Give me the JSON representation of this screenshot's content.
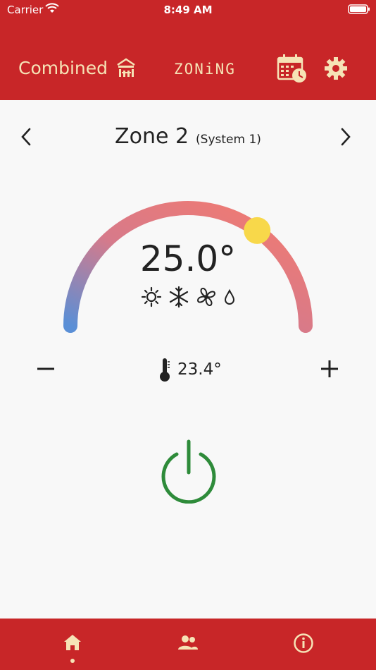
{
  "status_bar": {
    "carrier": "Carrier",
    "time": "8:49 AM"
  },
  "header": {
    "mode_label": "Combined",
    "mode_icon": "building-icon",
    "brand": "ZONiNG",
    "schedule_icon": "calendar-clock-icon",
    "settings_icon": "gear-icon"
  },
  "zone": {
    "name": "Zone 2",
    "system": "(System 1)"
  },
  "thermostat": {
    "setpoint": "25.0°",
    "ambient": "23.4°",
    "modes": [
      "sun-icon",
      "snowflake-icon",
      "fan-icon",
      "drop-icon"
    ],
    "dial_level": 0.7
  },
  "colors": {
    "primary": "#c82628",
    "accent": "#f6e3b6",
    "power": "#2e8b3a",
    "knob": "#f8d84a"
  },
  "tabs": [
    "home-icon",
    "users-icon",
    "info-icon"
  ]
}
